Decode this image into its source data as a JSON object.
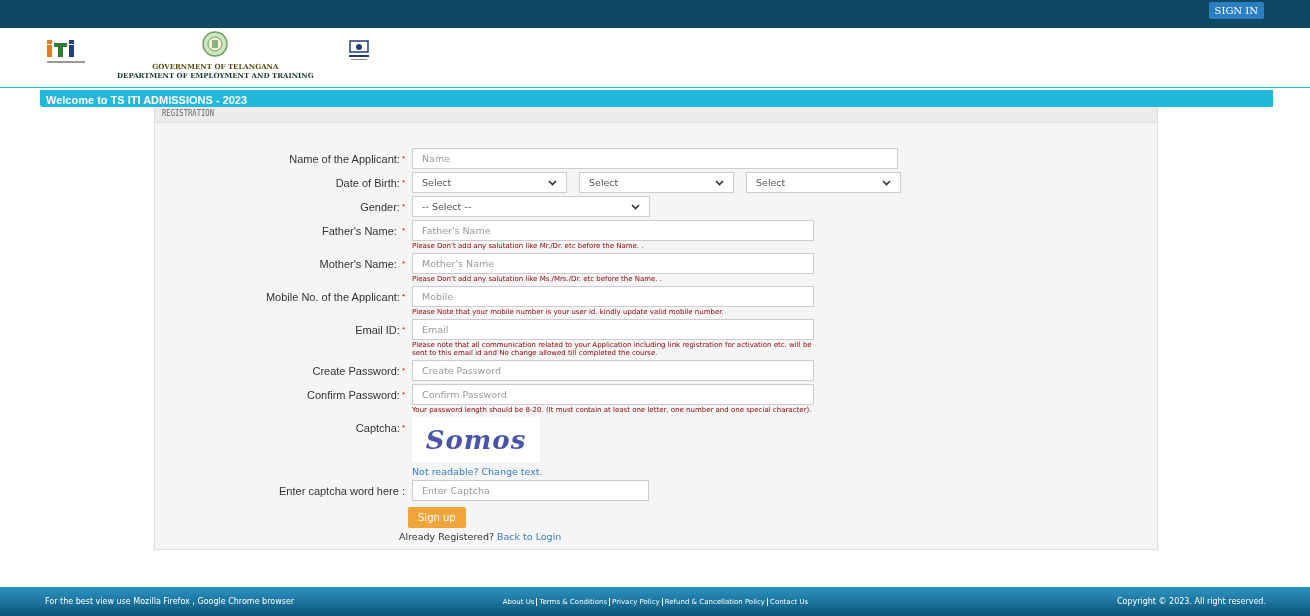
{
  "top_bar": {
    "sign_in": "SIGN IN"
  },
  "header": {
    "title_line_1": "GOVERNMENT OF TELANGANA",
    "title_line_2": "DEPARTMENT OF EMPLOYMENT AND TRAINING"
  },
  "banner": {
    "text": "Welcome to TS ITI ADMISSIONS - 2023"
  },
  "panel": {
    "heading": "REGISTRATION"
  },
  "fields": [
    {
      "kind": "long_text",
      "label": "Name of the Applicant:",
      "mark": "*",
      "placeholder": "Name"
    },
    {
      "kind": "selects",
      "label": "Date of Birth:",
      "mark": "*",
      "options": [
        "Select",
        "Select",
        "Select"
      ]
    },
    {
      "kind": "select",
      "label": "Gender:",
      "mark": "*",
      "value": "-- Select --"
    },
    {
      "kind": "text",
      "label": "Father's Name: ",
      "mark": "*",
      "placeholder": "Father's Name",
      "hint": "Please Don't add any salutation like Mr./Dr. etc before the Name. ."
    },
    {
      "kind": "text",
      "label": "Mother's Name: ",
      "mark": "*",
      "placeholder": "Mother's Name",
      "hint": "Please Don't add any salutation like Ms./Mrs./Dr. etc before the Name. ."
    },
    {
      "kind": "text",
      "label": "Mobile No. of the Applicant:",
      "mark": "*",
      "placeholder": "Mobile",
      "hint": "Please Note that your mobile number is your user id. kindly update valid mobile number."
    },
    {
      "kind": "text",
      "label": "Email ID:",
      "mark": "*",
      "placeholder": "Email",
      "hint": "Please note that all communication related to your Application including link registration for activation etc. will be sent to this email id and No change allowed till completed the course."
    },
    {
      "kind": "password",
      "label": "Create Password:",
      "mark": "*",
      "placeholder": "Create Password"
    },
    {
      "kind": "password",
      "label": "Confirm Password:",
      "mark": "*",
      "placeholder": "Confirm Password",
      "hint": "Your password length should be 8-20. (It must contain at least one letter, one number and one special character)."
    },
    {
      "kind": "captcha",
      "label": "Captcha:",
      "mark": "*",
      "captcha_text": "Somos",
      "change_link": "Not readable? Change text."
    },
    {
      "kind": "short_text",
      "label": "Enter captcha word here :",
      "placeholder": "Enter Captcha"
    }
  ],
  "submit": {
    "button": "Sign up",
    "already": "Already Registered?",
    "login_link": "Back to Login"
  },
  "footer": {
    "note": "For the best view use Mozilla Firefox , Google Chrome browser",
    "links": [
      "About Us",
      "Terms & Conditions",
      "Privacy Policy",
      "Refund & Cancellation Policy",
      "Contact Us"
    ],
    "copyright": "Copyright © 2023. All right reserved."
  }
}
